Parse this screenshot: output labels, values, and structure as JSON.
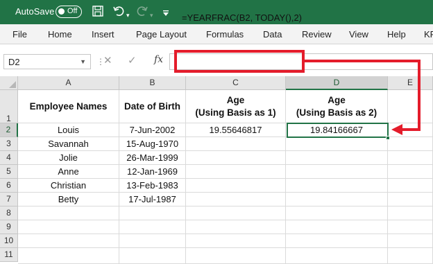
{
  "title_bar": {
    "autosave_label": "AutoSave",
    "autosave_state": "Off",
    "icons": [
      "save-icon",
      "undo-icon",
      "redo-icon",
      "customize-qat-icon"
    ]
  },
  "ribbon_tabs": [
    "File",
    "Home",
    "Insert",
    "Page Layout",
    "Formulas",
    "Data",
    "Review",
    "View",
    "Help",
    "KF"
  ],
  "formula_bar": {
    "name_box": "D2",
    "fx_label": "fx",
    "formula": "=YEARFRAC(B2, TODAY(),2)"
  },
  "columns": [
    "A",
    "B",
    "C",
    "D",
    "E"
  ],
  "selected_column": "D",
  "rows": [
    "1",
    "2",
    "3",
    "4",
    "5",
    "6",
    "7",
    "8",
    "9",
    "10",
    "11"
  ],
  "selected_row": "2",
  "headers": {
    "a": "Employee Names",
    "b": "Date of Birth",
    "c_line1": "Age",
    "c_line2": "(Using Basis as 1)",
    "d_line1": "Age",
    "d_line2": "(Using Basis as 2)"
  },
  "data_rows": [
    {
      "name": "Louis",
      "dob": "7-Jun-2002",
      "age1": "19.55646817",
      "age2": "19.84166667"
    },
    {
      "name": "Savannah",
      "dob": "15-Aug-1970",
      "age1": "",
      "age2": ""
    },
    {
      "name": "Jolie",
      "dob": "26-Mar-1999",
      "age1": "",
      "age2": ""
    },
    {
      "name": "Anne",
      "dob": "12-Jan-1969",
      "age1": "",
      "age2": ""
    },
    {
      "name": "Christian",
      "dob": "13-Feb-1983",
      "age1": "",
      "age2": ""
    },
    {
      "name": "Betty",
      "dob": "17-Jul-1987",
      "age1": "",
      "age2": ""
    }
  ],
  "colors": {
    "excel_green": "#217346",
    "highlight_red": "#e41c2b"
  }
}
